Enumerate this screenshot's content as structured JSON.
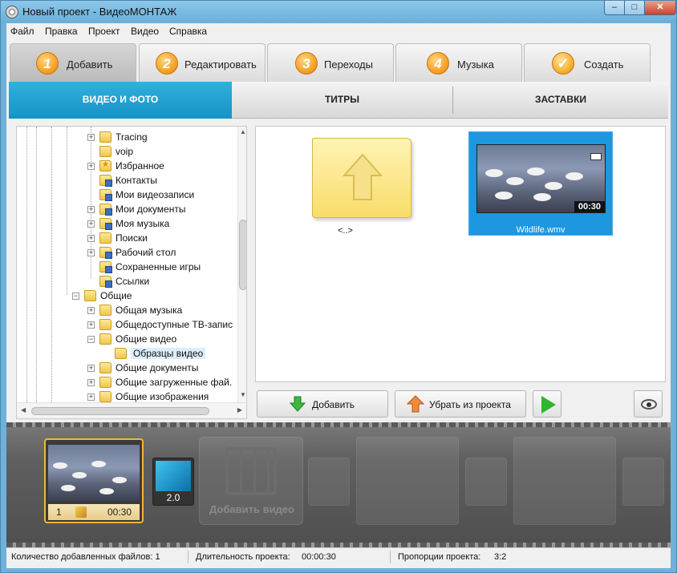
{
  "window": {
    "title": "Новый проект - ВидеоМОНТАЖ",
    "minimize": "–",
    "maximize": "□",
    "close": "✕"
  },
  "menu": [
    "Файл",
    "Правка",
    "Проект",
    "Видео",
    "Справка"
  ],
  "steps": [
    {
      "num": "1",
      "label": "Добавить"
    },
    {
      "num": "2",
      "label": "Редактировать"
    },
    {
      "num": "3",
      "label": "Переходы"
    },
    {
      "num": "4",
      "label": "Музыка"
    },
    {
      "num": "✓",
      "label": "Создать"
    }
  ],
  "subtabs": [
    "ВИДЕО И ФОТО",
    "ТИТРЫ",
    "ЗАСТАВКИ"
  ],
  "tree": [
    {
      "label": "Tracing",
      "expander": "+"
    },
    {
      "label": "voip",
      "expander": ""
    },
    {
      "label": "Избранное",
      "expander": "+"
    },
    {
      "label": "Контакты",
      "expander": ""
    },
    {
      "label": "Мои видеозаписи",
      "expander": ""
    },
    {
      "label": "Мои документы",
      "expander": "+"
    },
    {
      "label": "Моя музыка",
      "expander": "+"
    },
    {
      "label": "Поиски",
      "expander": "+"
    },
    {
      "label": "Рабочий стол",
      "expander": "+"
    },
    {
      "label": "Сохраненные игры",
      "expander": ""
    },
    {
      "label": "Ссылки",
      "expander": ""
    },
    {
      "label": "Общие",
      "expander": "−"
    },
    {
      "label": "Общая музыка",
      "expander": "+"
    },
    {
      "label": "Общедоступные ТВ-запис",
      "expander": "+"
    },
    {
      "label": "Общие видео",
      "expander": "−"
    },
    {
      "label": "Образцы видео",
      "expander": ""
    },
    {
      "label": "Общие документы",
      "expander": "+"
    },
    {
      "label": "Общие загруженные фай.",
      "expander": "+"
    },
    {
      "label": "Общие изображения",
      "expander": "+"
    }
  ],
  "browser": {
    "up_label": "<..>",
    "video_name": "Wildlife.wmv",
    "video_duration": "00:30"
  },
  "buttons": {
    "add": "Добавить",
    "remove": "Убрать из проекта"
  },
  "timeline": {
    "clip_number": "1",
    "clip_duration": "00:30",
    "transition_duration": "2.0",
    "add_video": "Добавить видео"
  },
  "status": {
    "files": "Количество добавленных файлов: 1",
    "duration_label": "Длительность проекта:",
    "duration_value": "00:00:30",
    "ratio_label": "Пропорции проекта:",
    "ratio_value": "3:2"
  },
  "colors": {
    "accent": "#1493c5",
    "title_bg": "#6fb1d8",
    "step_orange": "#f39a1c",
    "clip_border": "#f0b53e"
  }
}
